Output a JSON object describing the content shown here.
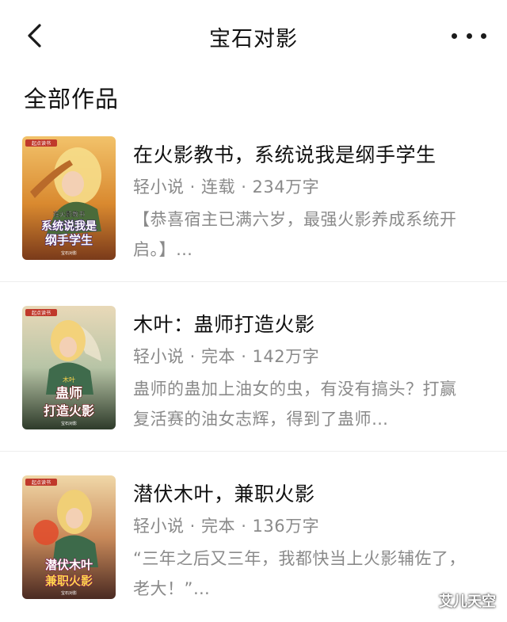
{
  "header": {
    "title": "宝石对影",
    "back_icon": "chevron-left-icon",
    "more_icon": "more-horizontal-icon"
  },
  "section": {
    "title": "全部作品"
  },
  "books": [
    {
      "title": "在火影教书，系统说我是纲手学生",
      "meta": "轻小说 · 连载 · 234万字",
      "description": "【恭喜宿主已满六岁，最强火影养成系统开启。】…",
      "cover": {
        "badge": "起点读书",
        "small_title": "在火影教书",
        "main_title_1": "系统说我是",
        "main_title_2": "纲手学生",
        "author": "宝石对影"
      }
    },
    {
      "title": "木叶：蛊师打造火影",
      "meta": "轻小说 · 完本 · 142万字",
      "description": "蛊师的蛊加上油女的虫，有没有搞头？打赢复活赛的油女志辉，得到了蛊师…",
      "cover": {
        "badge": "起点读书",
        "small_title": "木叶",
        "main_title_1": "蛊师",
        "main_title_2": "打造火影",
        "author": "宝石对影"
      }
    },
    {
      "title": "潜伏木叶，兼职火影",
      "meta": "轻小说 · 完本 · 136万字",
      "description": "“三年之后又三年，我都快当上火影辅佐了，老大！”…",
      "cover": {
        "badge": "起点读书",
        "small_title": "",
        "main_title_1": "潜伏木叶",
        "main_title_2": "兼职火影",
        "author": "宝石对影"
      }
    }
  ],
  "watermark": "艾儿天空"
}
